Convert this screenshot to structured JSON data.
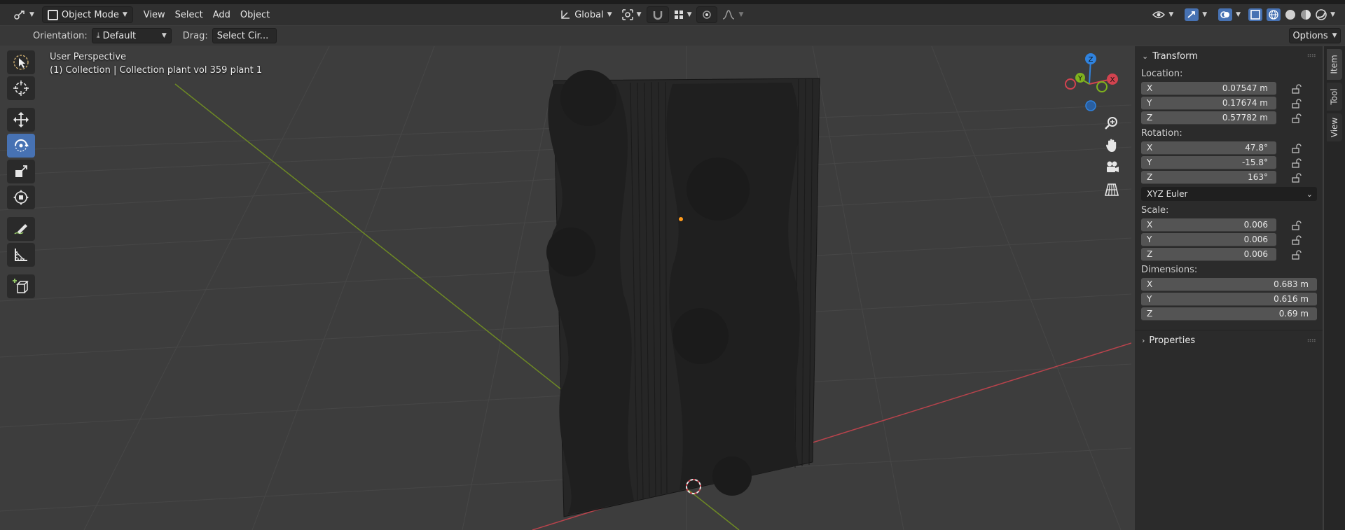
{
  "header": {
    "mode": "Object Mode",
    "menus": [
      "View",
      "Select",
      "Add",
      "Object"
    ],
    "transform_orientation": "Global"
  },
  "tool_header": {
    "orientation_label": "Orientation:",
    "orientation_value": "Default",
    "drag_label": "Drag:",
    "drag_value": "Select Cir...",
    "options": "Options"
  },
  "viewport": {
    "view_name": "User Perspective",
    "object_info": "(1) Collection | Collection plant vol 359 plant 1",
    "gizmo_axes": [
      "X",
      "Y",
      "Z"
    ],
    "colors": {
      "x_axis": "#d2434f",
      "y_axis": "#7fb21e",
      "z_axis": "#2f83e0",
      "origin": "#ff9a1a"
    }
  },
  "tools": [
    "select-box",
    "cursor",
    "move",
    "rotate",
    "scale",
    "transform",
    "annotate",
    "measure",
    "add-cube"
  ],
  "npanel": {
    "transform_title": "Transform",
    "location_label": "Location:",
    "location": [
      {
        "axis": "X",
        "value": "0.07547 m"
      },
      {
        "axis": "Y",
        "value": "0.17674 m"
      },
      {
        "axis": "Z",
        "value": "0.57782 m"
      }
    ],
    "rotation_label": "Rotation:",
    "rotation": [
      {
        "axis": "X",
        "value": "47.8°"
      },
      {
        "axis": "Y",
        "value": "-15.8°"
      },
      {
        "axis": "Z",
        "value": "163°"
      }
    ],
    "rotation_mode": "XYZ Euler",
    "scale_label": "Scale:",
    "scale": [
      {
        "axis": "X",
        "value": "0.006"
      },
      {
        "axis": "Y",
        "value": "0.006"
      },
      {
        "axis": "Z",
        "value": "0.006"
      }
    ],
    "dimensions_label": "Dimensions:",
    "dimensions": [
      {
        "axis": "X",
        "value": "0.683 m"
      },
      {
        "axis": "Y",
        "value": "0.616 m"
      },
      {
        "axis": "Z",
        "value": "0.69 m"
      }
    ],
    "properties_title": "Properties",
    "tabs": [
      "Item",
      "Tool",
      "View"
    ]
  }
}
